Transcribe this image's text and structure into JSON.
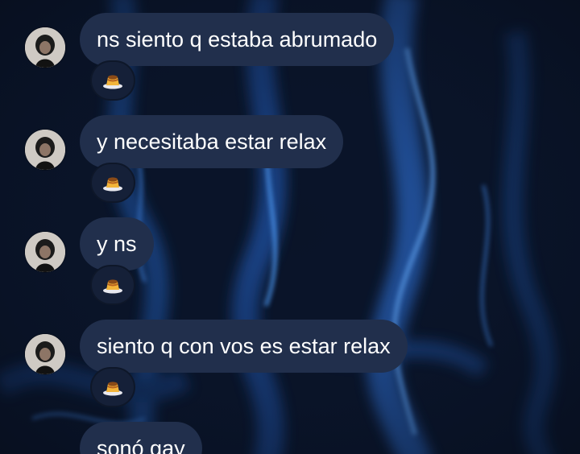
{
  "messages": [
    {
      "text": "ns siento q estaba abrumado",
      "reaction": "flan-pudding-emoji"
    },
    {
      "text": "y necesitaba estar relax",
      "reaction": "flan-pudding-emoji"
    },
    {
      "text": "y ns",
      "reaction": "flan-pudding-emoji"
    },
    {
      "text": "siento q con vos es estar relax",
      "reaction": "flan-pudding-emoji"
    },
    {
      "text": "sonó gay",
      "reaction": null
    }
  ],
  "colors": {
    "background": "#0a1428",
    "bubble": "#212f4c",
    "bubble_text": "#ffffff",
    "reaction_pill": "#152038",
    "accent_blue": "#3f86e6"
  }
}
